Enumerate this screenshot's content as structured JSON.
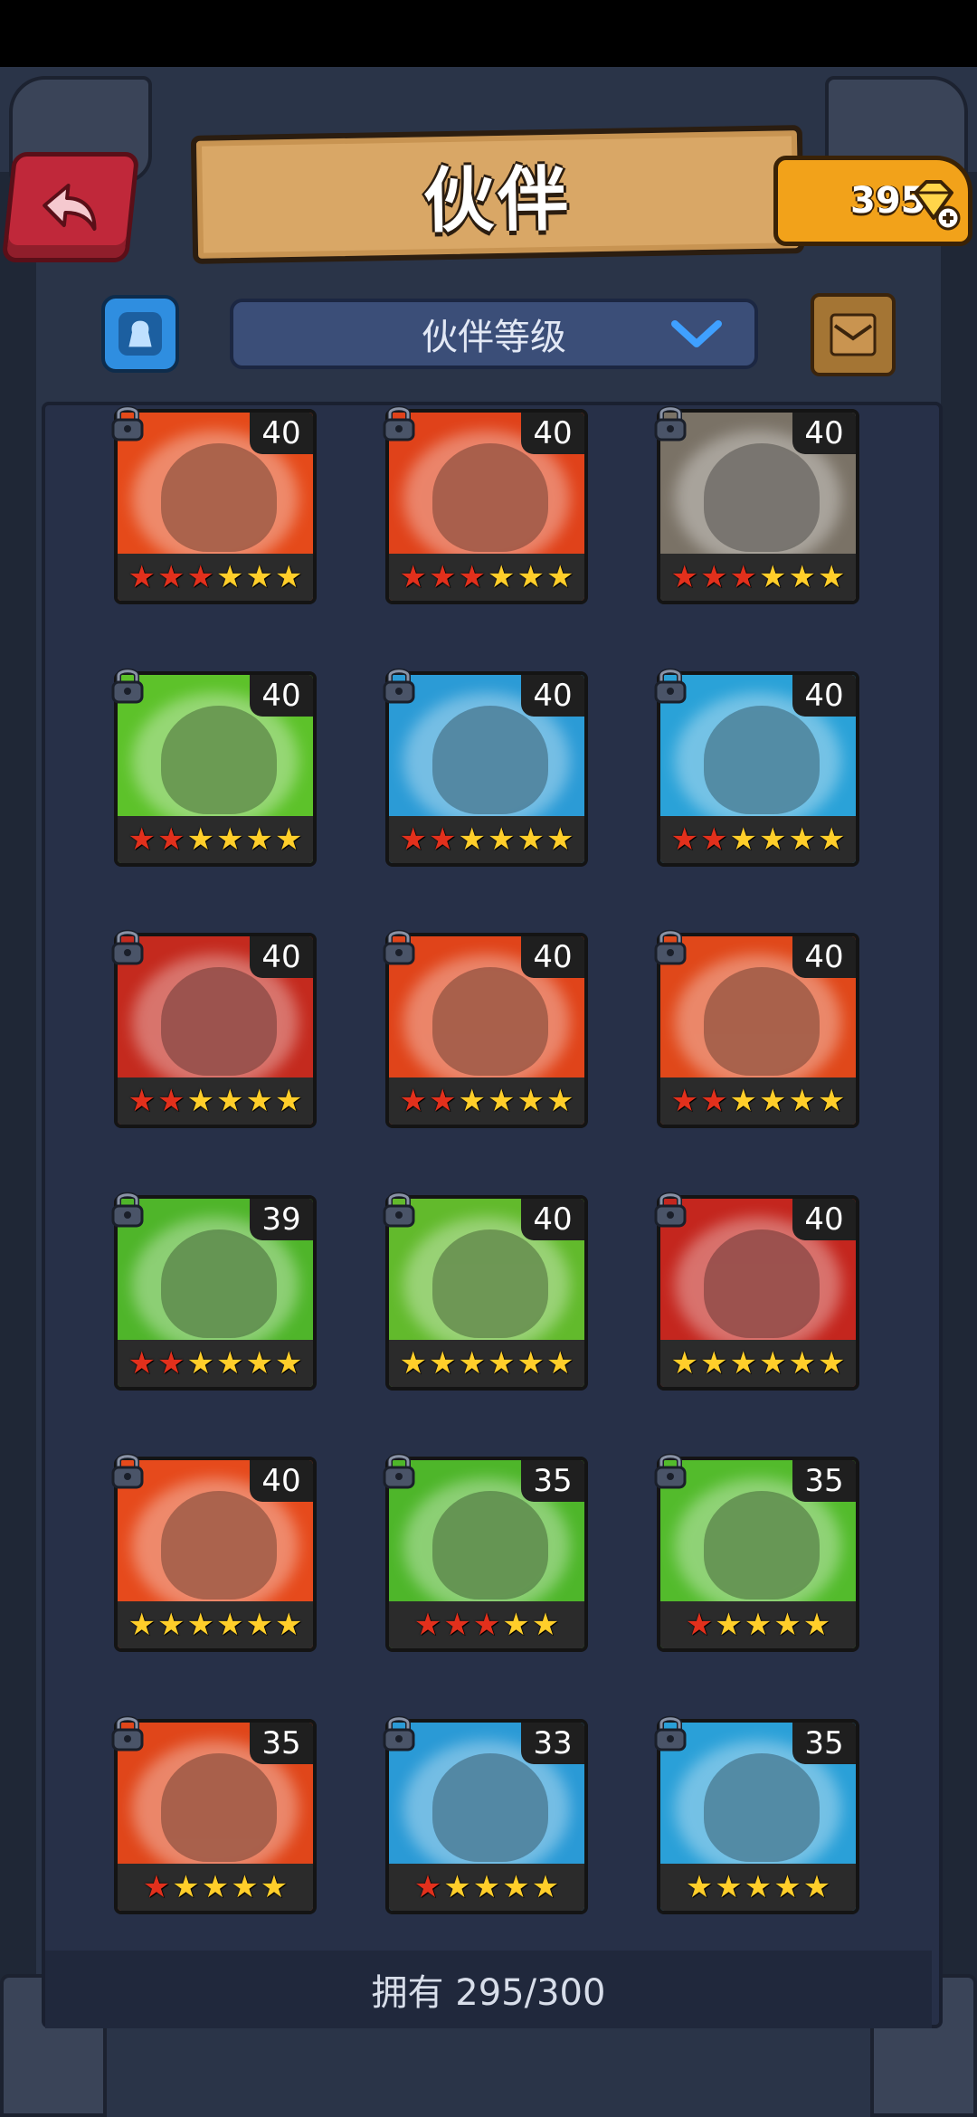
{
  "header": {
    "title": "伙伴",
    "gem_count": "395"
  },
  "filter": {
    "dropdown_label": "伙伴等级"
  },
  "heroes": [
    {
      "level": "40",
      "stars_total": 6,
      "stars_red": 3,
      "bg": "#e54a1a"
    },
    {
      "level": "40",
      "stars_total": 6,
      "stars_red": 3,
      "bg": "#e0421a"
    },
    {
      "level": "40",
      "stars_total": 6,
      "stars_red": 3,
      "bg": "#7a7266"
    },
    {
      "level": "40",
      "stars_total": 6,
      "stars_red": 2,
      "bg": "#5dc22a"
    },
    {
      "level": "40",
      "stars_total": 6,
      "stars_red": 2,
      "bg": "#2b9bd6"
    },
    {
      "level": "40",
      "stars_total": 6,
      "stars_red": 2,
      "bg": "#2aa2d8"
    },
    {
      "level": "40",
      "stars_total": 6,
      "stars_red": 2,
      "bg": "#c42a1e"
    },
    {
      "level": "40",
      "stars_total": 6,
      "stars_red": 2,
      "bg": "#e0441a"
    },
    {
      "level": "40",
      "stars_total": 6,
      "stars_red": 2,
      "bg": "#e0481a"
    },
    {
      "level": "39",
      "stars_total": 6,
      "stars_red": 2,
      "bg": "#4fb52a"
    },
    {
      "level": "40",
      "stars_total": 6,
      "stars_red": 0,
      "bg": "#62ba2c"
    },
    {
      "level": "40",
      "stars_total": 6,
      "stars_red": 0,
      "bg": "#c4261e"
    },
    {
      "level": "40",
      "stars_total": 6,
      "stars_red": 0,
      "bg": "#e64a1c"
    },
    {
      "level": "35",
      "stars_total": 5,
      "stars_red": 3,
      "bg": "#4eb62a"
    },
    {
      "level": "35",
      "stars_total": 5,
      "stars_red": 1,
      "bg": "#53bb2c"
    },
    {
      "level": "35",
      "stars_total": 5,
      "stars_red": 1,
      "bg": "#e0461a"
    },
    {
      "level": "33",
      "stars_total": 5,
      "stars_red": 1,
      "bg": "#2a9ad6"
    },
    {
      "level": "35",
      "stars_total": 5,
      "stars_red": 0,
      "bg": "#2aa0d8"
    }
  ],
  "footer": {
    "owned_text": "拥有 295/300"
  },
  "colors": {
    "frame": "#2a3448",
    "gold_star": "#ffce2a",
    "red_star": "#e2301c"
  },
  "icons": {
    "back": "back-arrow-icon",
    "gem": "diamond-plus-icon",
    "filter": "hero-filter-icon",
    "chevron": "chevron-down-icon",
    "map": "map-scroll-icon",
    "lock": "padlock-icon",
    "star": "star-icon"
  }
}
